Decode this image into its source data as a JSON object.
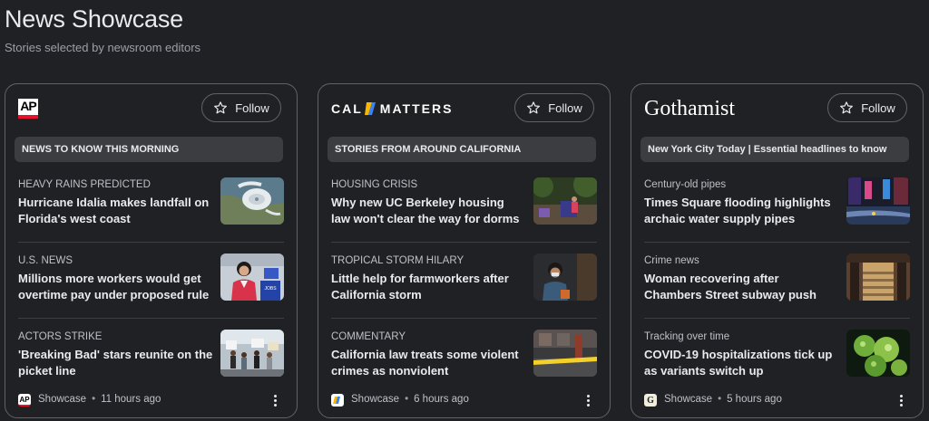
{
  "page": {
    "title": "News Showcase",
    "subtitle": "Stories selected by newsroom editors"
  },
  "cards": [
    {
      "logo_icon": "ap-logo",
      "logo_text": "AP",
      "follow_label": "Follow",
      "section": "NEWS TO KNOW THIS MORNING",
      "stories": [
        {
          "kicker": "HEAVY RAINS PREDICTED",
          "headline": "Hurricane Idalia makes landfall on Florida's west coast",
          "image": "hurricane-satellite-image"
        },
        {
          "kicker": "U.S. NEWS",
          "headline": "Millions more workers would get overtime pay under proposed rule",
          "image": "speaker-podium-image"
        },
        {
          "kicker": "ACTORS STRIKE",
          "headline": "'Breaking Bad' stars reunite on the picket line",
          "image": "picket-line-image"
        }
      ],
      "footer": {
        "source": "Showcase",
        "dot": "•",
        "time": "11 hours ago",
        "favicon_text": "AP"
      }
    },
    {
      "logo_icon": "calmatters-logo",
      "logo_text_left": "CAL",
      "logo_text_right": "MATTERS",
      "follow_label": "Follow",
      "section": "STORIES FROM AROUND CALIFORNIA",
      "stories": [
        {
          "kicker": "HOUSING CRISIS",
          "headline": "Why new UC Berkeley housing law won't clear the way for dorms",
          "image": "park-tents-image"
        },
        {
          "kicker": "TROPICAL STORM HILARY",
          "headline": "Little help for farmworkers after California storm",
          "image": "farmworker-portrait-image"
        },
        {
          "kicker": "COMMENTARY",
          "headline": "California law treats some violent crimes as nonviolent",
          "image": "crime-scene-tape-image"
        }
      ],
      "footer": {
        "source": "Showcase",
        "dot": "•",
        "time": "6 hours ago"
      }
    },
    {
      "logo_icon": "gothamist-logo",
      "logo_text": "Gothamist",
      "follow_label": "Follow",
      "section": "New York City Today | Essential headlines to know",
      "stories": [
        {
          "kicker": "Century-old pipes",
          "headline": "Times Square flooding highlights archaic water supply pipes",
          "image": "times-square-flood-image"
        },
        {
          "kicker": "Crime news",
          "headline": "Woman recovering after Chambers Street subway push",
          "image": "subway-stairs-image"
        },
        {
          "kicker": "Tracking over time",
          "headline": "COVID-19 hospitalizations tick up as variants switch up",
          "image": "covid-virus-image"
        }
      ],
      "footer": {
        "source": "Showcase",
        "dot": "•",
        "time": "5 hours ago",
        "favicon_text": "G"
      }
    }
  ],
  "colors": {
    "background": "#202124",
    "card_border": "#5f6368",
    "section_bar": "#3c3d40",
    "ap_red": "#e8112d",
    "calmatters_yellow": "#f5b700",
    "calmatters_blue": "#3b82f6"
  }
}
